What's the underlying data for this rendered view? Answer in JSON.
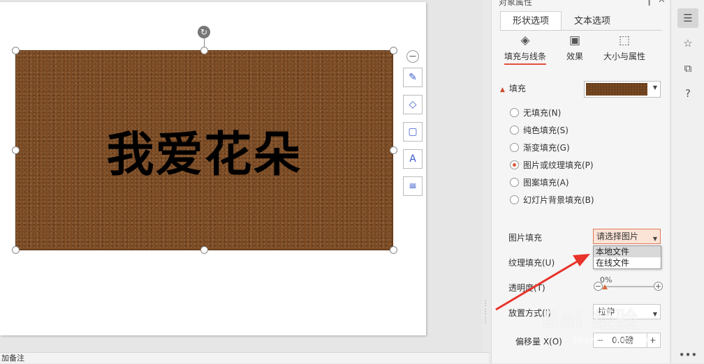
{
  "slide": {
    "shape_text": "我爱花朵",
    "shape_color": "#7b4a22"
  },
  "bottom": {
    "notes_hint": "加备注"
  },
  "panel": {
    "title": "对象属性",
    "pin_icon": "pin-icon",
    "close_icon": "close-icon",
    "tabs": [
      {
        "label": "形状选项",
        "active": true
      },
      {
        "label": "文本选项",
        "active": false
      }
    ],
    "subtabs": [
      {
        "label": "填充与线条",
        "icon": "fill-bucket-icon",
        "active": true
      },
      {
        "label": "效果",
        "icon": "effects-icon",
        "active": false
      },
      {
        "label": "大小与属性",
        "icon": "size-icon",
        "active": false
      }
    ],
    "fill_section": "填充",
    "fill_options": [
      {
        "label": "无填充(N)",
        "selected": false
      },
      {
        "label": "纯色填充(S)",
        "selected": false
      },
      {
        "label": "渐变填充(G)",
        "selected": false
      },
      {
        "label": "图片或纹理填充(P)",
        "selected": true
      },
      {
        "label": "图案填充(A)",
        "selected": false
      },
      {
        "label": "幻灯片背景填充(B)",
        "selected": false
      }
    ],
    "picture_fill_label": "图片填充",
    "picture_fill_value": "请选择图片",
    "picture_fill_options": [
      "本地文件",
      "在线文件"
    ],
    "texture_fill_label": "纹理填充(U)",
    "transparency_label": "透明度(T)",
    "transparency_value": "0%",
    "placement_label": "放置方式(I)",
    "placement_value": "拉伸",
    "offset_x_label": "偏移量 X(O)",
    "offset_x_value": "0.0磅"
  },
  "watermark": {
    "text": "Bai 经验",
    "sub": "jingyan.baidu.com"
  },
  "colors": {
    "accent": "#e0523c",
    "arrow": "#e8332a"
  }
}
